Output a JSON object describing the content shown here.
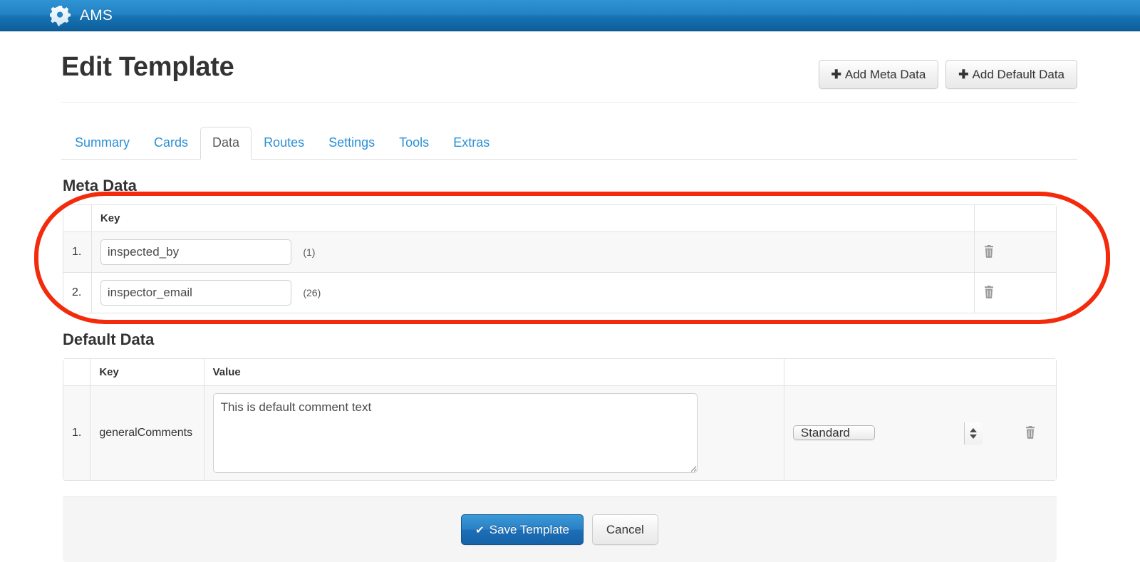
{
  "navbar": {
    "brand": "AMS",
    "logo_icon": "gear-icon"
  },
  "header": {
    "title": "Edit Template",
    "actions": [
      {
        "label": "Add Meta Data",
        "icon": "plus-icon"
      },
      {
        "label": "Add Default Data",
        "icon": "plus-icon"
      }
    ]
  },
  "tabs": [
    {
      "label": "Summary",
      "active": false
    },
    {
      "label": "Cards",
      "active": false
    },
    {
      "label": "Data",
      "active": true
    },
    {
      "label": "Routes",
      "active": false
    },
    {
      "label": "Settings",
      "active": false
    },
    {
      "label": "Tools",
      "active": false
    },
    {
      "label": "Extras",
      "active": false
    }
  ],
  "meta_data": {
    "section_title": "Meta Data",
    "columns": [
      "",
      "Key",
      ""
    ],
    "rows": [
      {
        "index": "1.",
        "key_value": "inspected_by",
        "count": "(1)",
        "delete_icon": "trash-icon"
      },
      {
        "index": "2.",
        "key_value": "inspector_email",
        "count": "(26)",
        "delete_icon": "trash-icon"
      }
    ]
  },
  "default_data": {
    "section_title": "Default Data",
    "columns": [
      "",
      "Key",
      "Value",
      "",
      ""
    ],
    "rows": [
      {
        "index": "1.",
        "key": "generalComments",
        "value": "This is default comment text",
        "type_selected": "Standard",
        "delete_icon": "trash-icon"
      }
    ]
  },
  "footer": {
    "save_label": "Save Template",
    "save_icon": "check-icon",
    "cancel_label": "Cancel"
  },
  "annotation": {
    "shape": "rounded-rectangle-highlight",
    "color": "#f32a0c",
    "targets": "meta-data-section"
  }
}
